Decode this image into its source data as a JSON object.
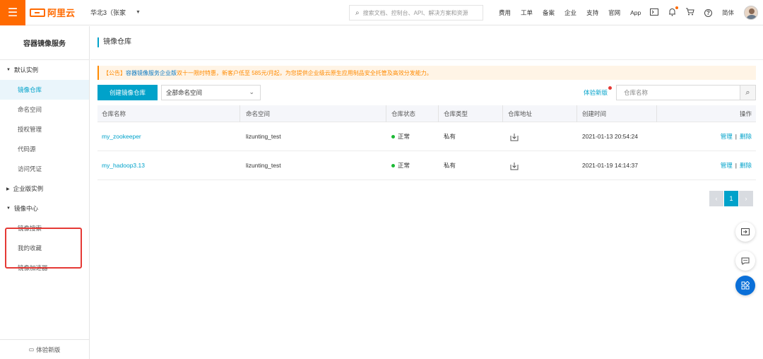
{
  "topbar": {
    "brand": "阿里云",
    "region": "华北3（张家",
    "search_placeholder": "搜索文档、控制台、API、解决方案和资源",
    "links": [
      "费用",
      "工单",
      "备案",
      "企业",
      "支持",
      "官网",
      "App"
    ],
    "lang": "简体"
  },
  "sidebar": {
    "title": "容器镜像服务",
    "group_default": "默认实例",
    "items_default": [
      "镜像仓库",
      "命名空间",
      "授权管理",
      "代码源",
      "访问凭证"
    ],
    "group_enterprise": "企业版实例",
    "group_center": "镜像中心",
    "items_center": [
      "镜像搜索",
      "我的收藏",
      "镜像加速器"
    ],
    "footer": "体验新版"
  },
  "main": {
    "page_title": "镜像仓库",
    "notice_prefix": "【公告】",
    "notice_link": "容器镜像服务企业版",
    "notice_mid": "双十一限时特惠",
    "notice_text": "，新客户低至 585元/月起，为您提供企业级云原生应用制品安全托管及高效分发能力。",
    "create_button": "创建镜像仓库",
    "namespace_select": "全部命名空间",
    "try_new": "体验新版",
    "repo_search_placeholder": "仓库名称",
    "columns": [
      "仓库名称",
      "命名空间",
      "仓库状态",
      "仓库类型",
      "仓库地址",
      "创建时间",
      "操作"
    ],
    "rows": [
      {
        "name": "my_zookeeper",
        "namespace": "lizunting_test",
        "status": "正常",
        "type": "私有",
        "created": "2021-01-13 20:54:24",
        "op_manage": "管理",
        "op_delete": "删除"
      },
      {
        "name": "my_hadoop3.13",
        "namespace": "lizunting_test",
        "status": "正常",
        "type": "私有",
        "created": "2021-01-19 14:14:37",
        "op_manage": "管理",
        "op_delete": "删除"
      }
    ],
    "pager": {
      "current": "1"
    }
  },
  "colors": {
    "brand": "#ff6a00",
    "accent": "#00a2ca",
    "status_ok": "#1bb934",
    "highlight_box": "#e53935"
  }
}
